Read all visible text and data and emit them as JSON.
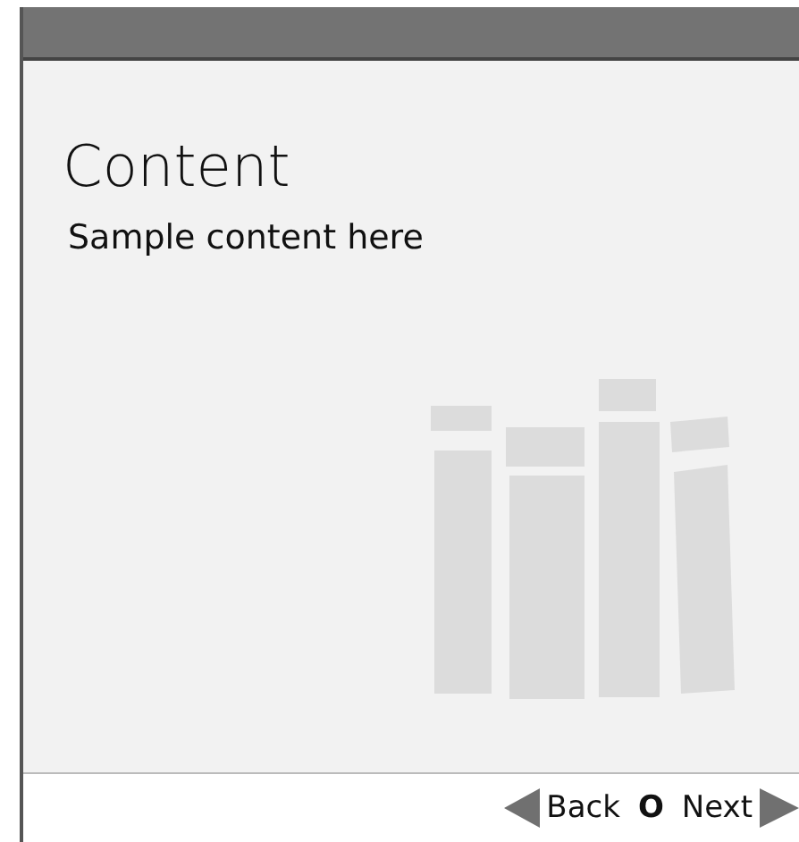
{
  "title": "Content",
  "subtitle": "Sample content here",
  "nav": {
    "back": "Back",
    "middle": "O",
    "next": "Next"
  }
}
